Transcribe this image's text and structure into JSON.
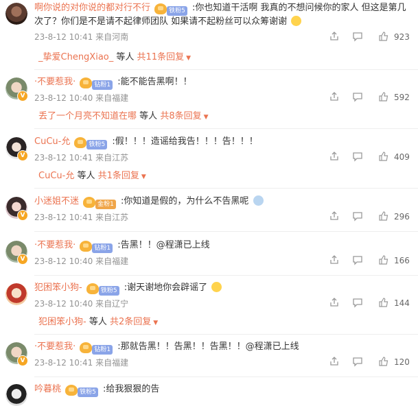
{
  "comments": [
    {
      "username": "啊你说的对你说的都对行不行",
      "badge": "铁粉5",
      "text": ":你也知道干活啊 我真的不想问候你的家人 但这是第几次了？你们是不是请不起律师团队 如果请不起粉丝可以众筹谢谢",
      "time": "23-8-12 10:41",
      "location": "来自河南",
      "likes": "923",
      "replies": {
        "name": "_挚爱ChengXiao_",
        "suffix": "等人",
        "count": "共11条回复"
      }
    },
    {
      "username": "·不要惹我·",
      "badge": "钻粉1",
      "text": ":能不能告黑啊！！",
      "time": "23-8-12 10:40",
      "location": "来自福建",
      "likes": "592",
      "replies": {
        "name": "丢了一个月亮不知道在哪",
        "suffix": "等人",
        "count": "共8条回复"
      }
    },
    {
      "username": "CuCu-允",
      "badge": "铁粉5",
      "text": ":假！！！造谣给我告！！！告！！！",
      "time": "23-8-12 10:41",
      "location": "来自江苏",
      "likes": "409",
      "replies": {
        "name": "CuCu-允",
        "suffix": "等人",
        "count": "共1条回复"
      }
    },
    {
      "username": "小迷姐不迷",
      "badge": "金粉1",
      "text": ":你知道是假的，为什么不告黑呢",
      "time": "23-8-12 10:41",
      "location": "来自江苏",
      "likes": "296"
    },
    {
      "username": "·不要惹我·",
      "badge": "钻粉1",
      "text": ":告黑！！@程潇已上线",
      "time": "23-8-12 10:40",
      "location": "来自福建",
      "likes": "166"
    },
    {
      "username": "犯困笨小狗-",
      "badge": "铁粉5",
      "text": ":谢天谢地你会辟谣了",
      "time": "23-8-12 10:40",
      "location": "来自辽宁",
      "likes": "144",
      "replies": {
        "name": "犯困笨小狗-",
        "suffix": "等人",
        "count": "共2条回复"
      }
    },
    {
      "username": "·不要惹我·",
      "badge": "钻粉1",
      "text": ":那就告黑！！告黑！！告黑！！@程潇已上线",
      "time": "23-8-12 10:41",
      "location": "来自福建",
      "likes": "120"
    },
    {
      "username": "吟暮桃",
      "badge": "铁粉5",
      "text": ":给我狠狠的告"
    }
  ],
  "icons": {
    "share": "share-icon",
    "comment": "comment-icon",
    "like": "thumbs-up-icon",
    "verified": "verified-v-icon"
  },
  "colors": {
    "username": "#eb7350",
    "meta": "#939393",
    "fan_badge": "#8aa4e8",
    "gold_badge": "#f0a64a"
  }
}
